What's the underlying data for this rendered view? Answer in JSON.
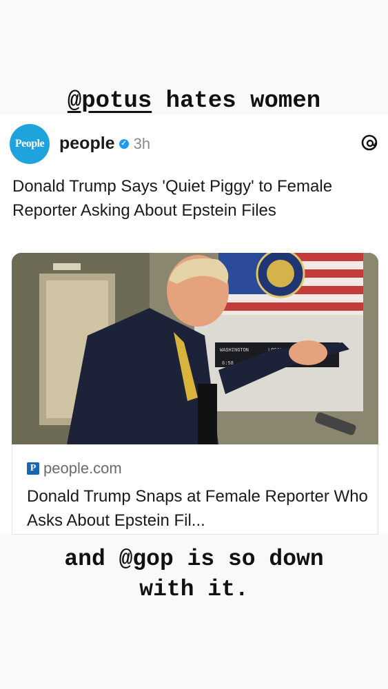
{
  "caption_top": {
    "mention": "@potus",
    "rest": " hates women"
  },
  "post": {
    "avatar_text": "People",
    "username": "people",
    "verified_icon": "verified-badge-icon",
    "time": "3h",
    "platform_icon": "threads-icon",
    "headline": "Donald Trump Says 'Quiet Piggy' to Female Reporter Asking About Epstein Files",
    "photo": {
      "screen_labels": [
        "WASHINGTON",
        "LOCAL",
        "6:58"
      ]
    },
    "link": {
      "site_badge": "P",
      "site": "people.com",
      "title": "Donald Trump Snaps at Female Reporter Who Asks About Epstein Fil..."
    }
  },
  "caption_bottom": {
    "line1": "and @gop is so down",
    "line2": "with it."
  },
  "colors": {
    "accent": "#1fa3dd",
    "verified": "#1d9bf0",
    "background": "#f8f9f9"
  }
}
